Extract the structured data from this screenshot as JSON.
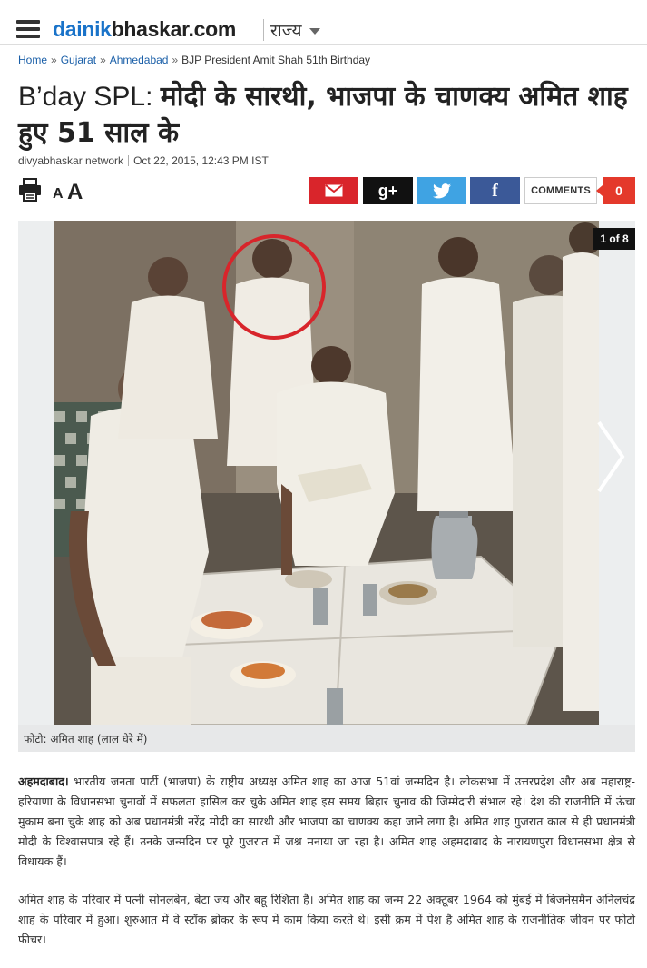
{
  "header": {
    "logo_part1": "dainik",
    "logo_part2": "bhaskar.com",
    "state_menu": "राज्य"
  },
  "breadcrumb": [
    "Home",
    "Gujarat",
    "Ahmedabad",
    "BJP President Amit Shah 51th Birthday"
  ],
  "article": {
    "headline_prefix": "B’day SPL: ",
    "headline": "मोदी के सारथी, भाजपा के चाणक्य अमित शाह हुए 51 साल के",
    "source": "divyabhaskar network",
    "timestamp": "Oct 22, 2015, 12:43 PM IST",
    "dateline": "अहमदाबाद।",
    "paragraph1": " भारतीय जनता पार्टी (भाजपा) के राष्ट्रीय अध्यक्ष अमित शाह का आज 51वां जन्मदिन है। लोकसभा में उत्तरप्रदेश और अब महाराष्ट्र-हरियाणा के विधानसभा चुनावों में सफलता हासिल कर चुके अमित शाह इस समय बिहार चुनाव की जिम्मेदारी संभाल रहे। देश की राजनीति में ऊंचा मुकाम बना चुके शाह को अब प्रधानमंत्री नरेंद्र मोदी का सारथी और भाजपा का चाणक्य कहा जाने लगा है। अमित शाह गुजरात काल से ही प्रधानमंत्री मोदी के विश्वासपात्र रहे हैं। उनके जन्मदिन पर पूरे गुजरात में जश्न मनाया जा रहा है। अमित शाह अहमदाबाद के नारायणपुरा विधानसभा क्षेत्र से विधायक हैं।",
    "paragraph2": "अमित शाह के परिवार में पत्नी सोनलबेन, बेटा जय और बहू रिशिता है। अमित शाह का जन्म 22 अक्टूबर 1964 को मुंबई में बिजनेसमैन अनिलचंद्र शाह के परिवार में हुआ। शुरुआत में वे स्टॉक ब्रोकर के रूप में काम किया करते थे। इसी क्रम में पेश है अमित शाह के राजनीतिक जीवन पर फोटो फीचर।"
  },
  "tools": {
    "font_small": "A",
    "font_large": "A"
  },
  "share": {
    "gplus_label": "g+",
    "facebook_label": "f",
    "comments_label": "COMMENTS",
    "comments_count": "0"
  },
  "gallery": {
    "counter": "1 of 8",
    "caption": "फोटो: अमित शाह (लाल घेरे में)"
  },
  "colors": {
    "brand_blue": "#1a73c9",
    "email_red": "#d9252b",
    "twitter_blue": "#3fa3e3",
    "facebook_blue": "#3b5998",
    "comments_red": "#e4392b"
  }
}
